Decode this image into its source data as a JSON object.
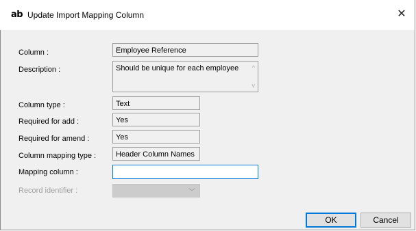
{
  "window": {
    "app_icon_text": "ab",
    "title": "Update Import Mapping Column",
    "close_glyph": "✕"
  },
  "fields": {
    "column": {
      "label": "Column :",
      "value": "Employee Reference"
    },
    "description": {
      "label": "Description :",
      "value": "Should be unique for each employee"
    },
    "column_type": {
      "label": "Column type :",
      "value": "Text"
    },
    "required_add": {
      "label": "Required for add  :",
      "value": "Yes"
    },
    "required_amend": {
      "label": "Required for amend :",
      "value": "Yes"
    },
    "mapping_type": {
      "label": "Column mapping type :",
      "value": "Header Column Names"
    },
    "mapping_column": {
      "label": "Mapping column :",
      "value": ""
    },
    "record_identifier": {
      "label": "Record identifier :",
      "value": ""
    }
  },
  "buttons": {
    "ok": "OK",
    "cancel": "Cancel"
  },
  "icons": {
    "scroll_up": "^",
    "scroll_down": "v",
    "chevron_down": "﹀"
  },
  "colors": {
    "accent": "#0078d7",
    "dialog_bg": "#f0f0f0",
    "disabled_text": "#a0a0a0"
  }
}
